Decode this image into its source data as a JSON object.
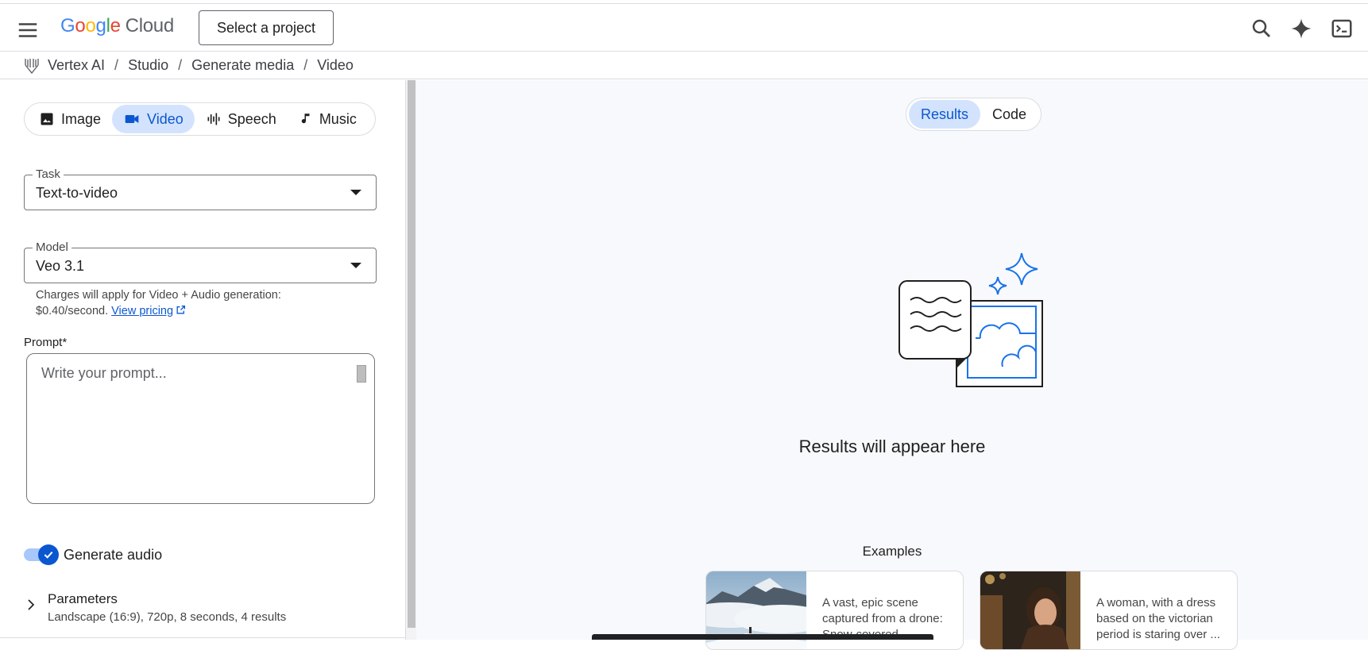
{
  "header": {
    "logo_google": [
      "G",
      "o",
      "o",
      "g",
      "l",
      "e"
    ],
    "logo_cloud": "Cloud",
    "project_button": "Select a project",
    "icons": [
      "menu-icon",
      "search-icon",
      "gemini-sparkle-icon",
      "cloud-shell-icon"
    ]
  },
  "breadcrumb": {
    "items": [
      "Vertex AI",
      "Studio",
      "Generate media",
      "Video"
    ],
    "separator": "/"
  },
  "media_tabs": [
    {
      "label": "Image",
      "icon": "image-icon",
      "active": false
    },
    {
      "label": "Video",
      "icon": "videocam-icon",
      "active": true
    },
    {
      "label": "Speech",
      "icon": "graphic-eq-icon",
      "active": false
    },
    {
      "label": "Music",
      "icon": "music-note-icon",
      "active": false
    }
  ],
  "task": {
    "label": "Task",
    "value": "Text-to-video"
  },
  "model": {
    "label": "Model",
    "value": "Veo 3.1",
    "charges_line1": "Charges will apply for Video + Audio generation:",
    "charges_line2": "$0.40/second.",
    "pricing_link": "View pricing"
  },
  "prompt": {
    "label": "Prompt*",
    "placeholder": "Write your prompt..."
  },
  "generate_audio": {
    "label": "Generate audio",
    "enabled": true
  },
  "parameters": {
    "title": "Parameters",
    "summary": "Landscape (16:9), 720p, 8 seconds, 4 results"
  },
  "results_toggle": [
    {
      "label": "Results",
      "active": true
    },
    {
      "label": "Code",
      "active": false
    }
  ],
  "results_empty": "Results will appear here",
  "examples": {
    "title": "Examples",
    "cards": [
      {
        "text_line1": "A vast, epic scene",
        "text_line2": "captured from a drone:",
        "text_line3": "Snow-covered ..."
      },
      {
        "text_line1": "A woman, with a dress",
        "text_line2": "based on the victorian",
        "text_line3": "period is staring over ..."
      }
    ]
  },
  "colors": {
    "accent": "#0b57d0",
    "accent_light": "#d3e3fd",
    "illustration_blue": "#1a73e8"
  }
}
